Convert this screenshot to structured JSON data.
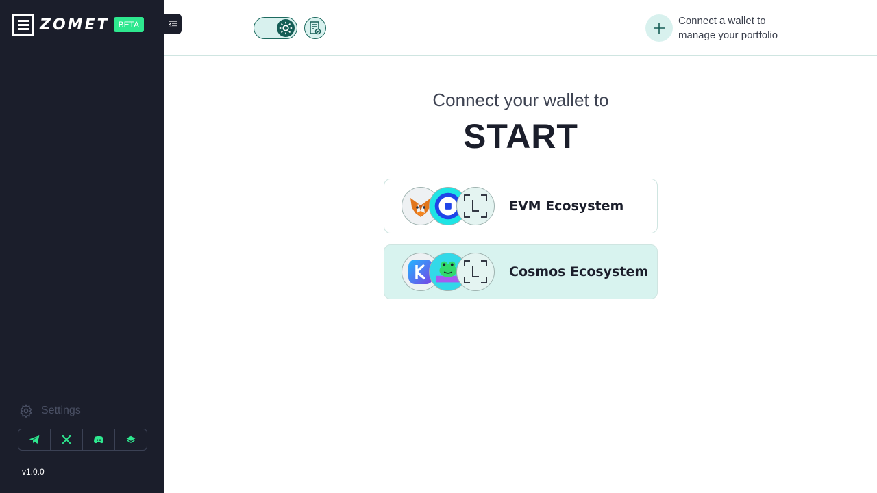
{
  "brand": {
    "name": "ZOMET",
    "badge": "BETA"
  },
  "sidebar": {
    "settings_label": "Settings",
    "socials": [
      "telegram-icon",
      "x-icon",
      "discord-icon",
      "stack-icon"
    ],
    "version": "v1.0.0"
  },
  "header": {
    "theme": "light",
    "connect_text": "Connect a wallet to manage your portfolio"
  },
  "main": {
    "headline_small": "Connect your wallet to",
    "headline_big": "START",
    "ecosystems": [
      {
        "label": "EVM Ecosystem",
        "wallets": [
          "metamask-icon",
          "walletconnect-icon",
          "ledger-icon"
        ]
      },
      {
        "label": "Cosmos Ecosystem",
        "wallets": [
          "keplr-icon",
          "leap-icon",
          "ledger-icon"
        ]
      }
    ]
  },
  "colors": {
    "sidebar_bg": "#1b1e2b",
    "accent": "#2ee88f",
    "teal": "#155e56",
    "mint": "#d8f3ef"
  }
}
